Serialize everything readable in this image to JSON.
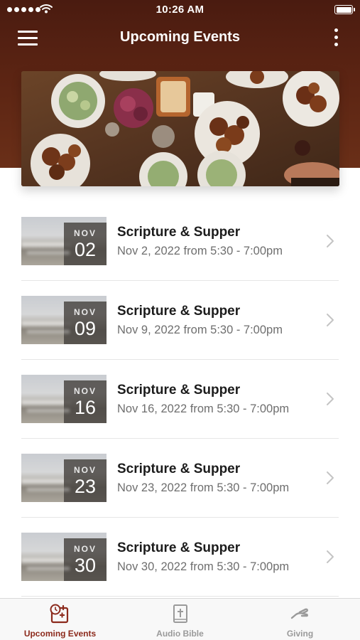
{
  "status_bar": {
    "time": "10:26 AM"
  },
  "nav": {
    "title": "Upcoming Events"
  },
  "hero": {
    "icon": "food-table-image"
  },
  "events": [
    {
      "month": "NOV",
      "day": "02",
      "title": "Scripture & Supper",
      "subtitle": "Nov 2, 2022 from 5:30 - 7:00pm"
    },
    {
      "month": "NOV",
      "day": "09",
      "title": "Scripture & Supper",
      "subtitle": "Nov 9, 2022 from 5:30 - 7:00pm"
    },
    {
      "month": "NOV",
      "day": "16",
      "title": "Scripture & Supper",
      "subtitle": "Nov 16, 2022 from 5:30 - 7:00pm"
    },
    {
      "month": "NOV",
      "day": "23",
      "title": "Scripture & Supper",
      "subtitle": "Nov 23, 2022 from 5:30 - 7:00pm"
    },
    {
      "month": "NOV",
      "day": "30",
      "title": "Scripture & Supper",
      "subtitle": "Nov 30, 2022 from 5:30 - 7:00pm"
    }
  ],
  "tabs": [
    {
      "label": "Upcoming Events",
      "icon": "calendar-clock-icon",
      "active": true
    },
    {
      "label": "Audio Bible",
      "icon": "bible-icon",
      "active": false
    },
    {
      "label": "Giving",
      "icon": "giving-hand-icon",
      "active": false
    }
  ],
  "colors": {
    "accent": "#8c2a1c",
    "header": "#5b2413",
    "tab_inactive": "#9a9a9a"
  }
}
